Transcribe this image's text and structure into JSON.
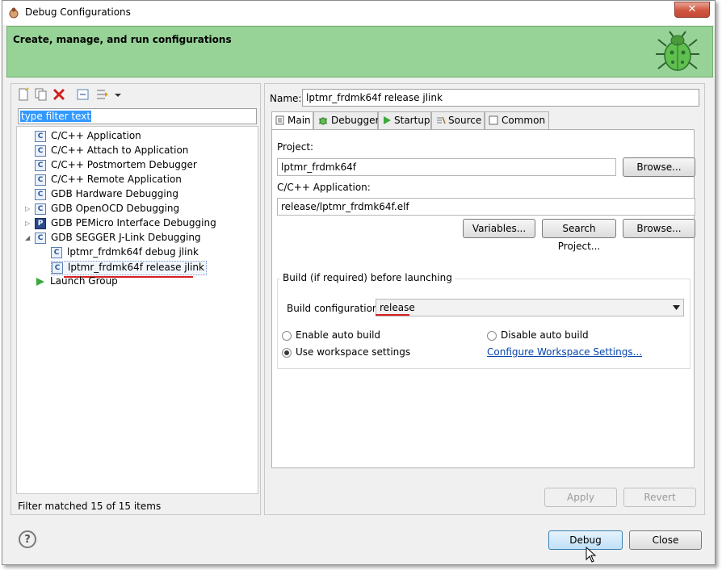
{
  "window": {
    "title": "Debug Configurations",
    "close_glyph": "✕"
  },
  "banner": {
    "title": "Create, manage, and run configurations",
    "icon": "bug-icon"
  },
  "left": {
    "filter_placeholder": "type filter text",
    "tree": [
      {
        "label": "C/C++ Application",
        "icon": "c-config-icon"
      },
      {
        "label": "C/C++ Attach to Application",
        "icon": "c-config-icon"
      },
      {
        "label": "C/C++ Postmortem Debugger",
        "icon": "c-config-icon"
      },
      {
        "label": "C/C++ Remote Application",
        "icon": "c-config-icon"
      },
      {
        "label": "GDB Hardware Debugging",
        "icon": "c-config-icon"
      },
      {
        "label": "GDB OpenOCD Debugging",
        "icon": "c-config-icon"
      },
      {
        "label": "GDB PEMicro Interface Debugging",
        "icon": "pe-config-icon"
      },
      {
        "label": "GDB SEGGER J-Link Debugging",
        "icon": "c-config-icon"
      },
      {
        "label": "lptmr_frdmk64f debug jlink",
        "icon": "c-config-icon"
      },
      {
        "label": "lptmr_frdmk64f release jlink",
        "icon": "c-config-icon"
      },
      {
        "label": "Launch Group",
        "icon": "launch-group-icon"
      }
    ],
    "status": "Filter matched 15 of 15 items"
  },
  "right": {
    "name_label": "Name:",
    "name_value": "lptmr_frdmk64f release jlink",
    "tabs": [
      "Main",
      "Debugger",
      "Startup",
      "Source",
      "Common"
    ],
    "project_label": "Project:",
    "project_value": "lptmr_frdmk64f",
    "browse_label": "Browse...",
    "app_label": "C/C++ Application:",
    "app_value": "release/lptmr_frdmk64f.elf",
    "variables_label": "Variables...",
    "search_project_label": "Search Project...",
    "build_group_title": "Build (if required) before launching",
    "build_config_label": "Build configuration:",
    "build_config_value": "release",
    "enable_auto_build": "Enable auto build",
    "disable_auto_build": "Disable auto build",
    "use_workspace": "Use workspace settings",
    "configure_workspace": "Configure Workspace Settings...",
    "apply_label": "Apply",
    "revert_label": "Revert"
  },
  "footer": {
    "debug_label": "Debug",
    "close_label": "Close",
    "help_glyph": "?"
  },
  "colors": {
    "banner_green": "#97d297",
    "selection_blue": "#3399ff",
    "highlight_red": "#d81f1f",
    "link_blue": "#0645ad"
  }
}
